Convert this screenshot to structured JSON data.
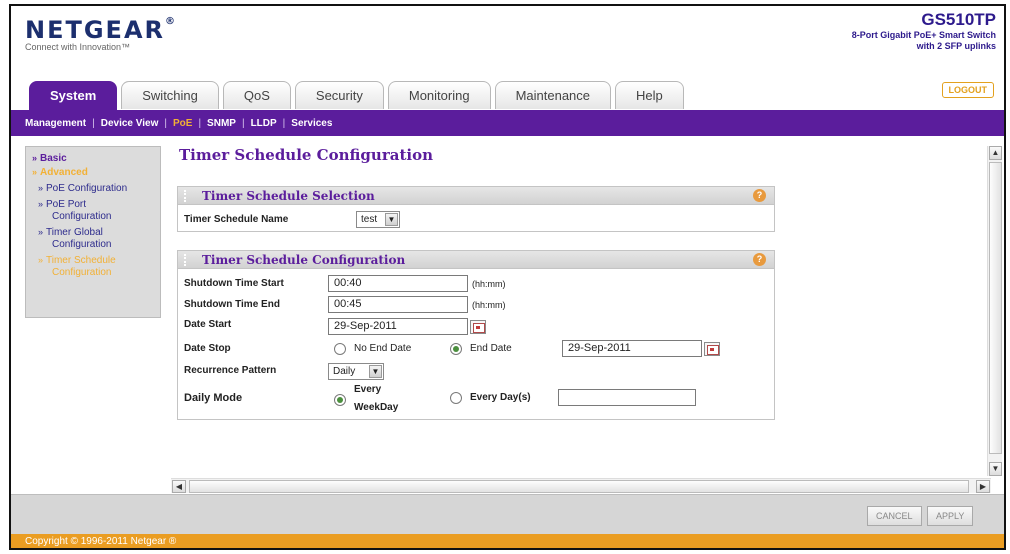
{
  "brand": {
    "name": "NETGEAR",
    "registered": "®",
    "tagline": "Connect with Innovation™",
    "model": "GS510TP",
    "description_line1": "8-Port Gigabit PoE+ Smart Switch",
    "description_line2": "with 2 SFP uplinks",
    "logout_label": "LOGOUT"
  },
  "tabs": [
    {
      "label": "System",
      "active": true
    },
    {
      "label": "Switching"
    },
    {
      "label": "QoS"
    },
    {
      "label": "Security"
    },
    {
      "label": "Monitoring"
    },
    {
      "label": "Maintenance"
    },
    {
      "label": "Help"
    }
  ],
  "subnav": [
    {
      "label": "Management"
    },
    {
      "label": "Device View"
    },
    {
      "label": "PoE",
      "active": true
    },
    {
      "label": "SNMP"
    },
    {
      "label": "LLDP"
    },
    {
      "label": "Services"
    }
  ],
  "subnav_separator": "|",
  "sidebar": {
    "basic": "Basic",
    "advanced": "Advanced",
    "items": [
      {
        "line1": "PoE Configuration",
        "line2": ""
      },
      {
        "line1": "PoE Port",
        "line2": "Configuration"
      },
      {
        "line1": "Timer Global",
        "line2": "Configuration"
      },
      {
        "line1": "Timer Schedule",
        "line2": "Configuration",
        "active": true
      }
    ]
  },
  "page": {
    "title": "Timer Schedule Configuration"
  },
  "selection_panel": {
    "title": "Timer Schedule Selection",
    "name_label": "Timer Schedule Name",
    "name_value": "test"
  },
  "config_panel": {
    "title": "Timer Schedule Configuration",
    "shutdown_start_label": "Shutdown Time Start",
    "shutdown_start_value": "00:40",
    "shutdown_end_label": "Shutdown Time End",
    "shutdown_end_value": "00:45",
    "time_hint": "(hh:mm)",
    "date_start_label": "Date Start",
    "date_start_value": "29-Sep-2011",
    "date_stop_label": "Date Stop",
    "no_end_date_label": "No End Date",
    "end_date_label": "End Date",
    "end_date_value": "29-Sep-2011",
    "recurrence_label": "Recurrence Pattern",
    "recurrence_value": "Daily",
    "daily_mode_label": "Daily Mode",
    "every_weekday_line1": "Every",
    "every_weekday_line2": "WeekDay",
    "every_days_label": "Every Day(s)",
    "every_days_value": ""
  },
  "footer": {
    "cancel_label": "CANCEL",
    "apply_label": "APPLY",
    "copyright": "Copyright © 1996-2011 Netgear ®"
  },
  "help_glyph": "?",
  "icons": {
    "dropdown": "chevron-down-icon",
    "calendar": "calendar-icon",
    "help": "help-icon"
  },
  "colors": {
    "accent_purple": "#5b1d9c",
    "accent_orange": "#ea9d22",
    "brand_blue": "#1c2f6e"
  }
}
